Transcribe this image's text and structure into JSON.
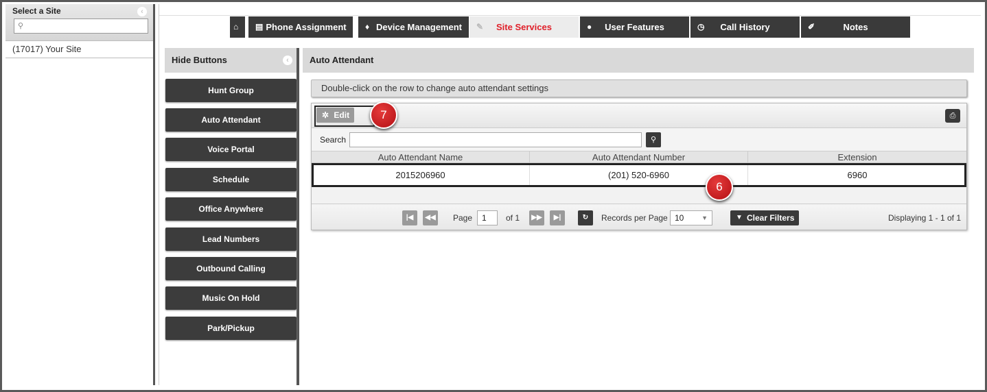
{
  "site_panel": {
    "title": "Select a Site",
    "search_placeholder": "",
    "sites": [
      "(17017) Your Site"
    ]
  },
  "tabs": [
    {
      "label": "",
      "icon": "home-icon"
    },
    {
      "label": "Phone Assignment",
      "icon": "list-icon"
    },
    {
      "label": "Device Management",
      "icon": "bell-icon"
    },
    {
      "label": "Site Services",
      "icon": "edit-icon",
      "active": true
    },
    {
      "label": "User Features",
      "icon": "user-icon"
    },
    {
      "label": "Call History",
      "icon": "clock-icon"
    },
    {
      "label": "Notes",
      "icon": "pencil-icon"
    }
  ],
  "sidebar": {
    "title": "Hide Buttons",
    "buttons": [
      "Hunt Group",
      "Auto Attendant",
      "Voice Portal",
      "Schedule",
      "Office Anywhere",
      "Lead Numbers",
      "Outbound Calling",
      "Music On Hold",
      "Park/Pickup"
    ]
  },
  "content": {
    "title": "Auto Attendant",
    "notice": "Double-click on the row to change auto attendant settings",
    "edit_label": "Edit",
    "search_label": "Search",
    "search_value": "",
    "columns": [
      "Auto Attendant Name",
      "Auto Attendant Number",
      "Extension"
    ],
    "rows": [
      [
        "2015206960",
        "(201) 520-6960",
        "6960"
      ]
    ],
    "pager": {
      "page_label": "Page",
      "page_value": "1",
      "of_label": "of 1",
      "records_label": "Records per Page",
      "records_value": "10",
      "clear_filters": "Clear Filters",
      "displaying": "Displaying 1 - 1 of 1"
    }
  },
  "callouts": [
    "7",
    "6"
  ],
  "colors": {
    "accent": "#e0202a",
    "dark_button": "#3c3c3c",
    "callout": "#c4161c"
  }
}
